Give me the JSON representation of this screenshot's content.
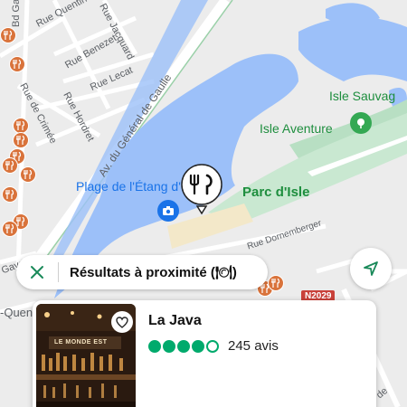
{
  "map": {
    "streets": [
      {
        "id": "bd-gambetta",
        "text": "Bd Gambe"
      },
      {
        "id": "rue-quentin",
        "text": "Rue Quentin"
      },
      {
        "id": "rue-jacquard",
        "text": "Rue Jacquard"
      },
      {
        "id": "rue-benezet",
        "text": "Rue Benezet"
      },
      {
        "id": "rue-lecat",
        "text": "Rue Lecat"
      },
      {
        "id": "rue-de-crimee",
        "text": "Rue de Crimée"
      },
      {
        "id": "rue-hordret",
        "text": "Rue Hordret"
      },
      {
        "id": "av-gen-gaulle",
        "text": "Av. du Général de Gaulle"
      },
      {
        "id": "rue-dornemberger",
        "text": "Rue Dornemberger"
      },
      {
        "id": "rue-gaya",
        "text": "Gaya"
      },
      {
        "id": "rue-quen-bottom",
        "text": "-Quen"
      },
      {
        "id": "rue-de-bottom",
        "text": "de"
      }
    ],
    "places": {
      "isle_sauvage": "Isle Sauvag",
      "isle_aventure": "Isle Aventure",
      "plage": "Plage de l'Étang d'Isl",
      "parc": "Parc d'Isle",
      "road_badge": "N2029"
    },
    "colors": {
      "water": "#9cc0f9",
      "park": "#c9e8d1",
      "park_text": "#1e8e3e",
      "poi_blue": "#1a73e8",
      "food": "#d9733b"
    }
  },
  "search": {
    "close_icon": "close-icon",
    "text": "Résultats à proximité (🍽)"
  },
  "locate": {
    "icon": "navigation-arrow-icon"
  },
  "card": {
    "title": "La Java",
    "rating_filled": 4,
    "rating_max": 5,
    "reviews": "245 avis",
    "photo_sign": "LE MONDE EST",
    "rating_color": "#00aa6c"
  }
}
